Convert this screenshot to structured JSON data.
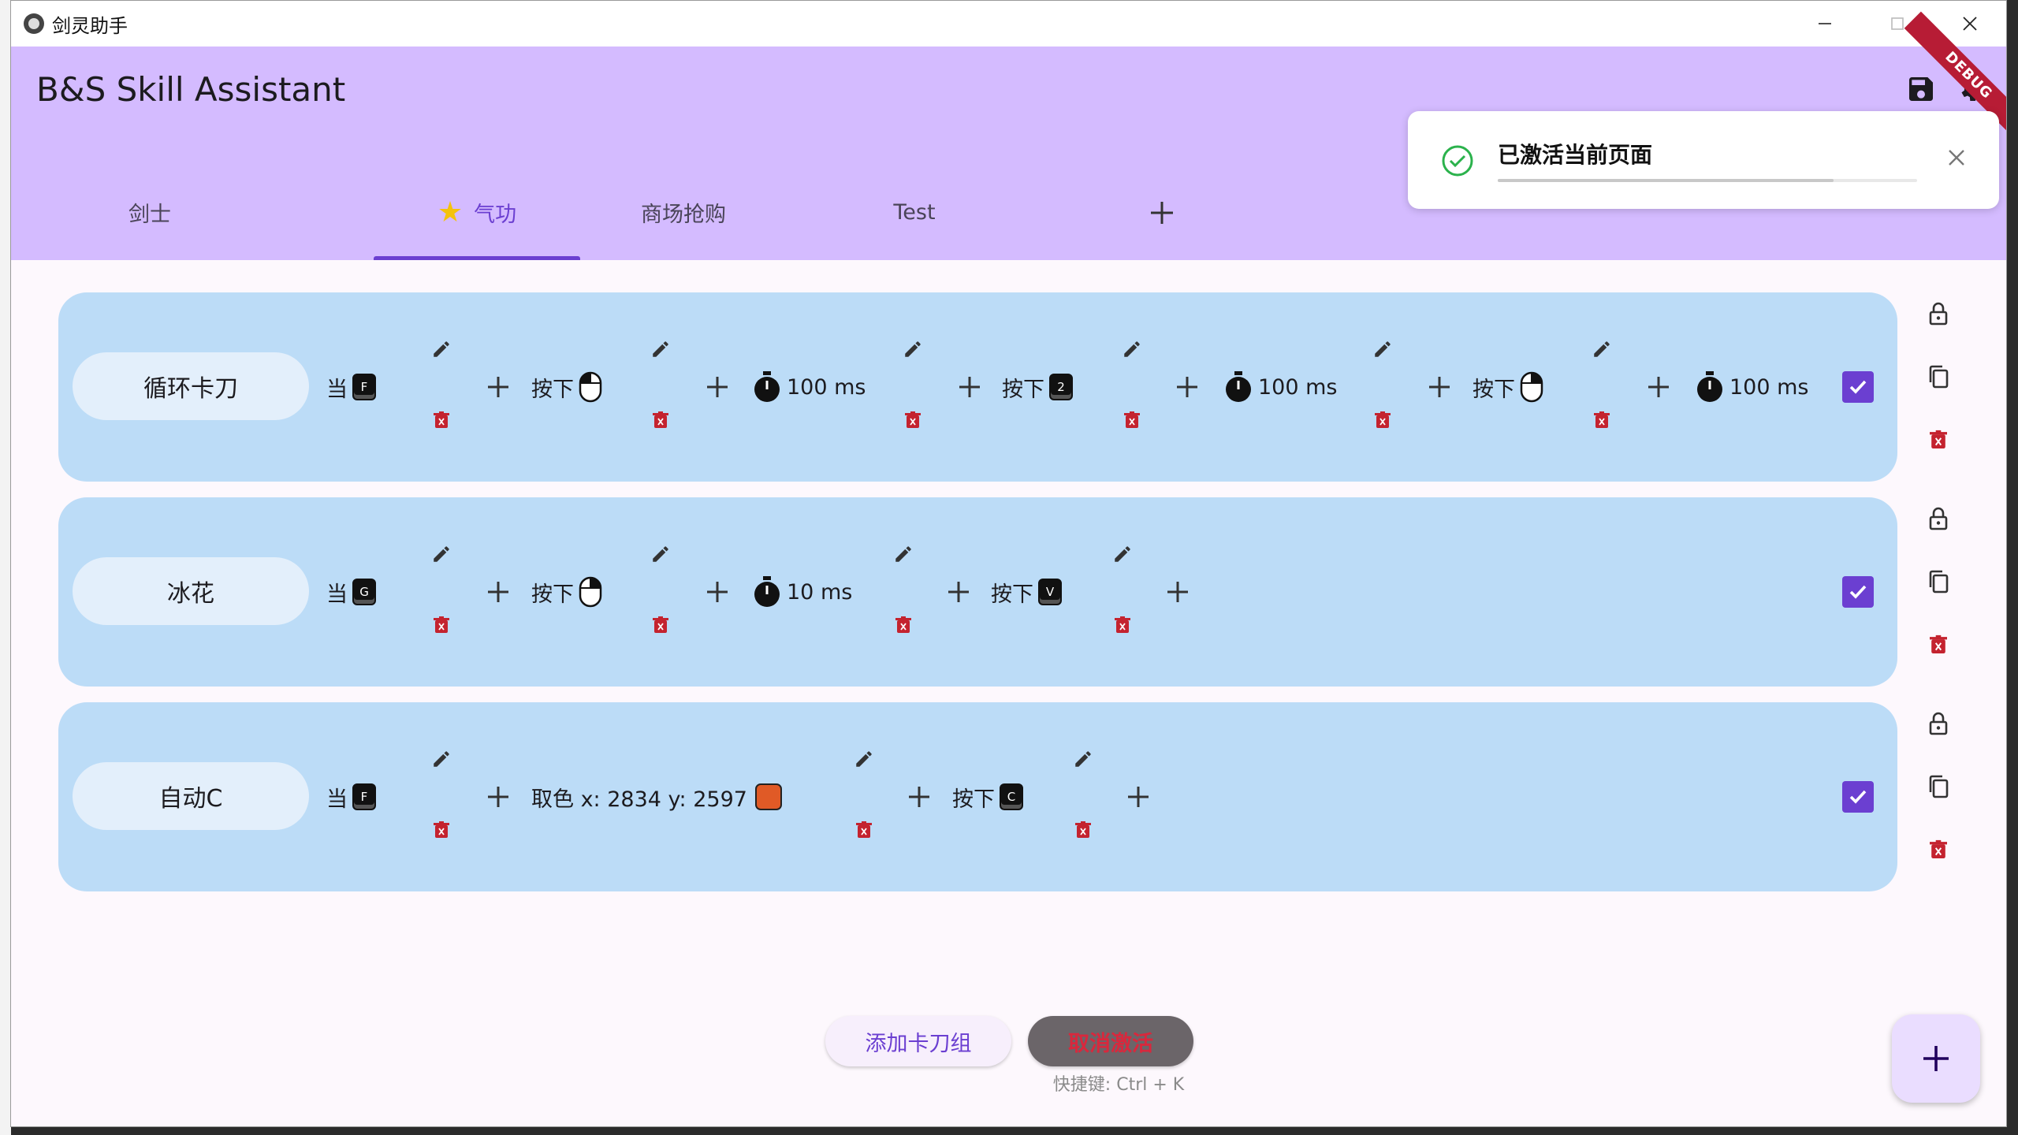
{
  "window": {
    "title": "剑灵助手"
  },
  "app": {
    "title": "B&S Skill Assistant",
    "debug_label": "DEBUG"
  },
  "tabs": [
    {
      "label": "剑士",
      "active": false
    },
    {
      "label": "气功",
      "active": true,
      "starred": true
    },
    {
      "label": "商场抢购",
      "active": false
    },
    {
      "label": "Test",
      "active": false
    }
  ],
  "toast": {
    "message": "已激活当前页面",
    "progress": 0.8
  },
  "groups": [
    {
      "name": "循环卡刀",
      "trigger": {
        "label": "当",
        "key": "F"
      },
      "actions": [
        {
          "label": "按下",
          "mouse": "left"
        },
        {
          "timer": "100 ms"
        },
        {
          "label": "按下",
          "key": "2"
        },
        {
          "timer": "100 ms"
        },
        {
          "label": "按下",
          "mouse": "right-scroll"
        },
        {
          "timer": "100 ms"
        }
      ],
      "checked": true
    },
    {
      "name": "冰花",
      "trigger": {
        "label": "当",
        "key": "G"
      },
      "actions": [
        {
          "label": "按下",
          "mouse": "right-scroll"
        },
        {
          "timer": "10 ms"
        },
        {
          "label": "按下",
          "key": "V"
        }
      ],
      "checked": true
    },
    {
      "name": "自动C",
      "trigger": {
        "label": "当",
        "key": "F"
      },
      "actions": [
        {
          "label": "取色 x: 2834 y: 2597",
          "color": "#e05a26"
        },
        {
          "label": "按下",
          "key": "C"
        }
      ],
      "checked": true
    }
  ],
  "bottom": {
    "add_group": "添加卡刀组",
    "deactivate": "取消激活",
    "shortcut": "快捷键: Ctrl + K"
  },
  "colors": {
    "appbar": "#d4bbff",
    "accent": "#6b3fd1",
    "row": "#bcdcf7",
    "delete": "#c4232f"
  }
}
